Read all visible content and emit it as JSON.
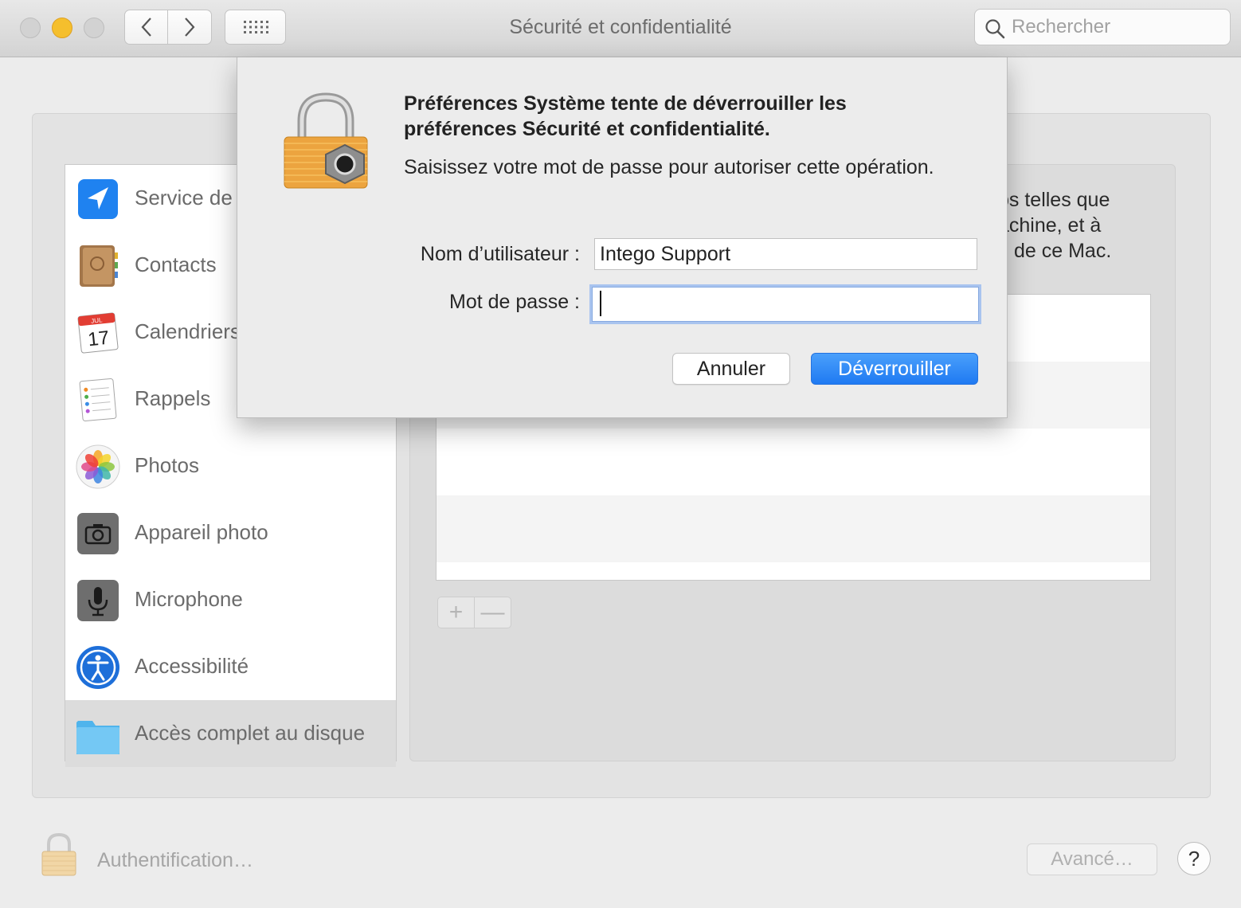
{
  "window": {
    "title": "Sécurité et confidentialité",
    "search_placeholder": "Rechercher"
  },
  "sidebar": {
    "items": [
      {
        "label": "Service de",
        "icon": "location-arrow-icon"
      },
      {
        "label": "Contacts",
        "icon": "contacts-book-icon"
      },
      {
        "label": "Calendriers",
        "icon": "calendar-icon",
        "icon_text": {
          "month": "JUL",
          "day": "17"
        }
      },
      {
        "label": "Rappels",
        "icon": "reminders-icon"
      },
      {
        "label": "Photos",
        "icon": "photos-icon"
      },
      {
        "label": "Appareil photo",
        "icon": "camera-icon"
      },
      {
        "label": "Microphone",
        "icon": "microphone-icon"
      },
      {
        "label": "Accessibilité",
        "icon": "accessibility-icon"
      },
      {
        "label": "Accès complet au disque",
        "icon": "folder-icon",
        "selected": true
      }
    ]
  },
  "panel": {
    "description_lines": [
      "ps telles que",
      "achine, et à",
      "de ce Mac."
    ],
    "add_label": "+",
    "remove_label": "—"
  },
  "dialog": {
    "heading": "Préférences Système tente de déverrouiller les préférences Sécurité et confidentialité.",
    "message": "Saisissez votre mot de passe pour autoriser cette opération.",
    "username_label": "Nom d’utilisateur :",
    "username_value": "Intego Support",
    "password_label": "Mot de passe :",
    "password_value": "",
    "cancel_label": "Annuler",
    "unlock_label": "Déverrouiller"
  },
  "footer": {
    "auth_label": "Authentification…",
    "advanced_label": "Avancé…",
    "help_label": "?"
  },
  "colors": {
    "accent": "#1f7af2",
    "traffic_minimize": "#f5bf2d"
  }
}
